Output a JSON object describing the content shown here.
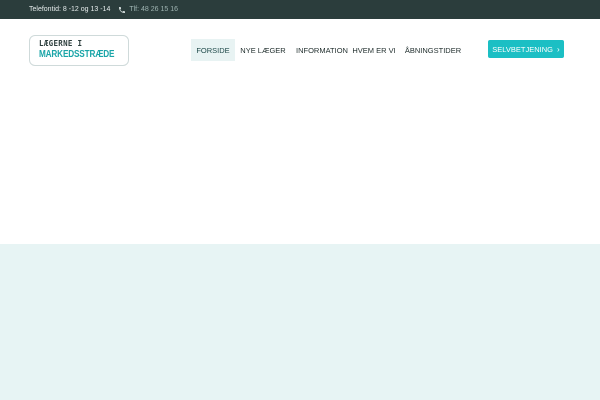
{
  "topbar": {
    "hours": "Telefontid: 8 -12 og 13 -14",
    "phone": "Tlf: 48 26 15 16",
    "phone_icon": "phone-icon"
  },
  "logo": {
    "line1": "LÆGERNE I",
    "line2": "MARKEDSSTRÆDE"
  },
  "nav": {
    "items": [
      {
        "label": "FORSIDE",
        "active": true
      },
      {
        "label": "NYE LÆGER",
        "active": false
      },
      {
        "label": "INFORMATION",
        "active": false
      },
      {
        "label": "HVEM ER VI",
        "active": false
      },
      {
        "label": "ÅBNINGSTIDER",
        "active": false
      }
    ]
  },
  "cta": {
    "label": "SELVBETJENING",
    "icon": "chevron-right-icon"
  },
  "colors": {
    "topbar_bg": "#2b3d3c",
    "accent": "#1bbfc4",
    "band_bg": "#e7f4f4"
  }
}
